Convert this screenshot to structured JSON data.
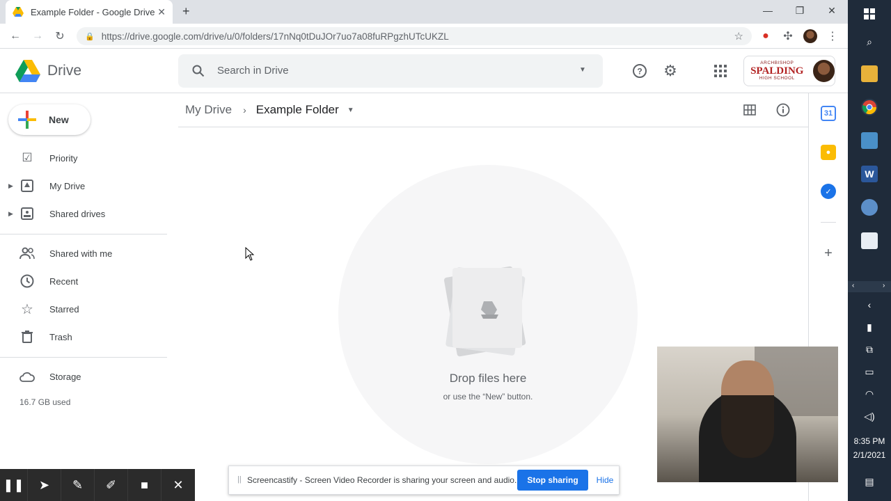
{
  "browser": {
    "tab_title": "Example Folder - Google Drive",
    "new_tab": "+",
    "url": "https://drive.google.com/drive/u/0/folders/17nNq0tDuJOr7uo7a08fuRPgzhUTcUKZL",
    "window_controls": [
      "minimize-icon",
      "restore-icon",
      "close-icon"
    ]
  },
  "header": {
    "app_name": "Drive",
    "search_placeholder": "Search in Drive",
    "school": {
      "line1": "ARCHBISHOP",
      "line2": "SPALDING",
      "line3": "HIGH SCHOOL"
    }
  },
  "sidebar": {
    "new_label": "New",
    "items": [
      {
        "label": "Priority",
        "icon": "priority-check-icon"
      },
      {
        "label": "My Drive",
        "icon": "my-drive-icon"
      },
      {
        "label": "Shared drives",
        "icon": "shared-drives-icon"
      },
      {
        "label": "Shared with me",
        "icon": "people-icon"
      },
      {
        "label": "Recent",
        "icon": "clock-icon"
      },
      {
        "label": "Starred",
        "icon": "star-icon"
      },
      {
        "label": "Trash",
        "icon": "trash-icon"
      }
    ],
    "storage_label": "Storage",
    "storage_used": "16.7 GB used"
  },
  "main": {
    "breadcrumb_root": "My Drive",
    "breadcrumb_current": "Example Folder",
    "empty_title": "Drop files here",
    "empty_subtitle": "or use the “New” button."
  },
  "taskbar": {
    "time": "8:35 PM",
    "date": "2/1/2021"
  },
  "screencastify": {
    "message": "Screencastify - Screen Video Recorder is sharing your screen and audio.",
    "stop_label": "Stop sharing",
    "hide_label": "Hide"
  },
  "colors": {
    "accent_blue": "#1a73e8",
    "chrome_tab_bg": "#dee1e6",
    "taskbar_bg": "#1f2b3a",
    "school_red": "#b22222"
  }
}
